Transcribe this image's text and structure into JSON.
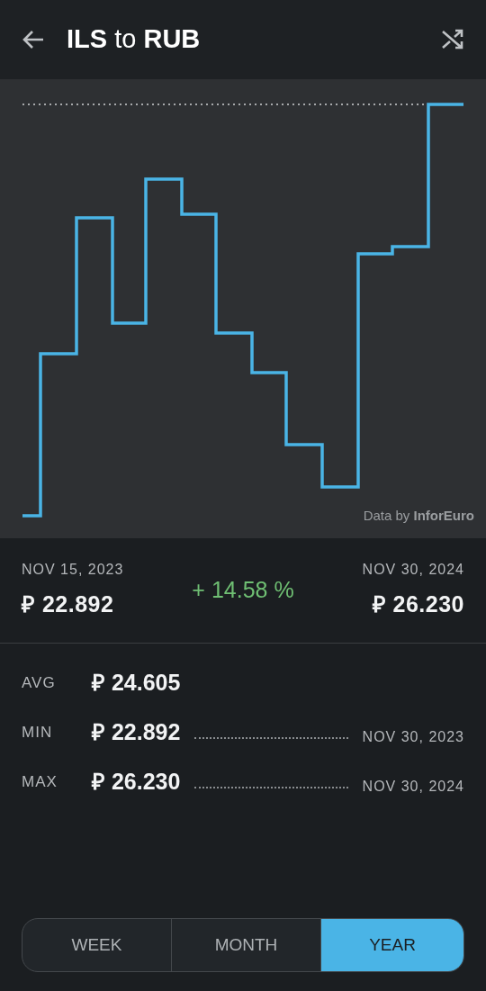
{
  "header": {
    "title": "**ILS** to **RUB**"
  },
  "chart": {
    "credit": "Data by **InforEuro**"
  },
  "summary": {
    "start_date": "NOV 15, 2023",
    "start_value": "₽ 22.892",
    "change": "+ 14.58 %",
    "end_date": "NOV 30, 2024",
    "end_value": "₽ 26.230"
  },
  "stats": [
    {
      "label": "AVG",
      "value": "₽ 24.605"
    },
    {
      "label": "MIN",
      "value": "₽ 22.892",
      "date": "NOV 30, 2023"
    },
    {
      "label": "MAX",
      "value": "₽ 26.230",
      "date": "NOV 30, 2024"
    }
  ],
  "periods": [
    {
      "label": "WEEK",
      "selected": false
    },
    {
      "label": "MONTH",
      "selected": false
    },
    {
      "label": "YEAR",
      "selected": true
    }
  ]
}
